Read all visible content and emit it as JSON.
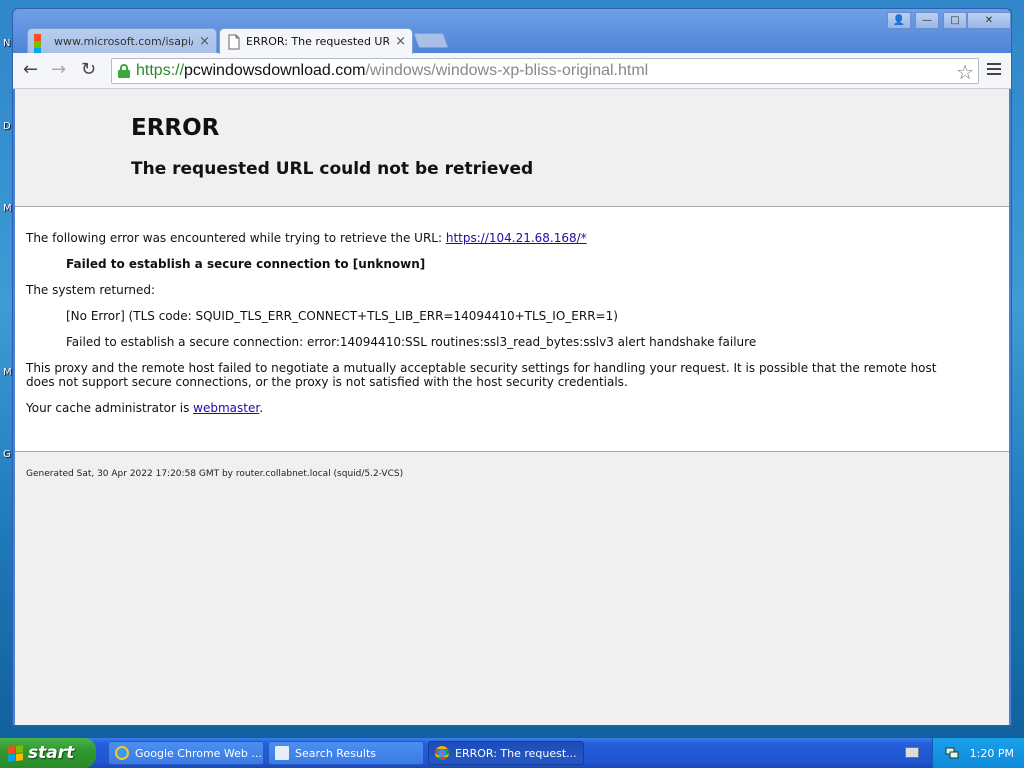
{
  "desktop": {
    "fragments": [
      "N",
      "D",
      "M",
      "M",
      "G"
    ]
  },
  "window": {
    "tabs": [
      {
        "title": "www.microsoft.com/isapi/re",
        "close": "×",
        "active": false
      },
      {
        "title": "ERROR: The requested URL",
        "close": "×",
        "active": true
      }
    ],
    "controls": {
      "user": "👤",
      "minimize": "—",
      "maximize": "□",
      "close": "✕"
    }
  },
  "toolbar": {
    "back": "←",
    "forward": "→",
    "reload": "↻",
    "url": {
      "scheme": "https://",
      "host": "pcwindowsdownload.com",
      "path": "/windows/windows-xp-bliss-original.html"
    },
    "star": "☆"
  },
  "page": {
    "title": "ERROR",
    "subtitle": "The requested URL could not be retrieved",
    "intro": "The following error was encountered while trying to retrieve the URL: ",
    "intro_link": "https://104.21.68.168/*",
    "failure": "Failed to establish a secure connection to [unknown]",
    "system_returned": "The system returned:",
    "tls_error": "[No Error] (TLS code: SQUID_TLS_ERR_CONNECT+TLS_LIB_ERR=14094410+TLS_IO_ERR=1)",
    "ssl_error": "Failed to establish a secure connection: error:14094410:SSL routines:ssl3_read_bytes:sslv3 alert handshake failure",
    "explanation_line1": "This proxy and the remote host failed to negotiate a mutually acceptable security settings for handling your request. It is possible that the remote host",
    "explanation_line2": "does not support secure connections, or the proxy is not satisfied with the host security credentials.",
    "admin_prefix": "Your cache administrator is ",
    "admin_link": "webmaster",
    "admin_suffix": ".",
    "footer": "Generated Sat, 30 Apr 2022 17:20:58 GMT by router.collabnet.local (squid/5.2-VCS)"
  },
  "taskbar": {
    "start_label": "start",
    "tasks": [
      {
        "label": "Google Chrome Web ...",
        "icon": "ie-icon"
      },
      {
        "label": "Search Results",
        "icon": "search-results-icon"
      },
      {
        "label": "ERROR: The request...",
        "icon": "chrome-icon"
      }
    ],
    "clock": "1:20 PM"
  },
  "colors": {
    "link": "#1a0dab",
    "secure_green": "#2a8a2a",
    "taskbar_blue": "#245edb",
    "start_green": "#2f9a2f"
  }
}
